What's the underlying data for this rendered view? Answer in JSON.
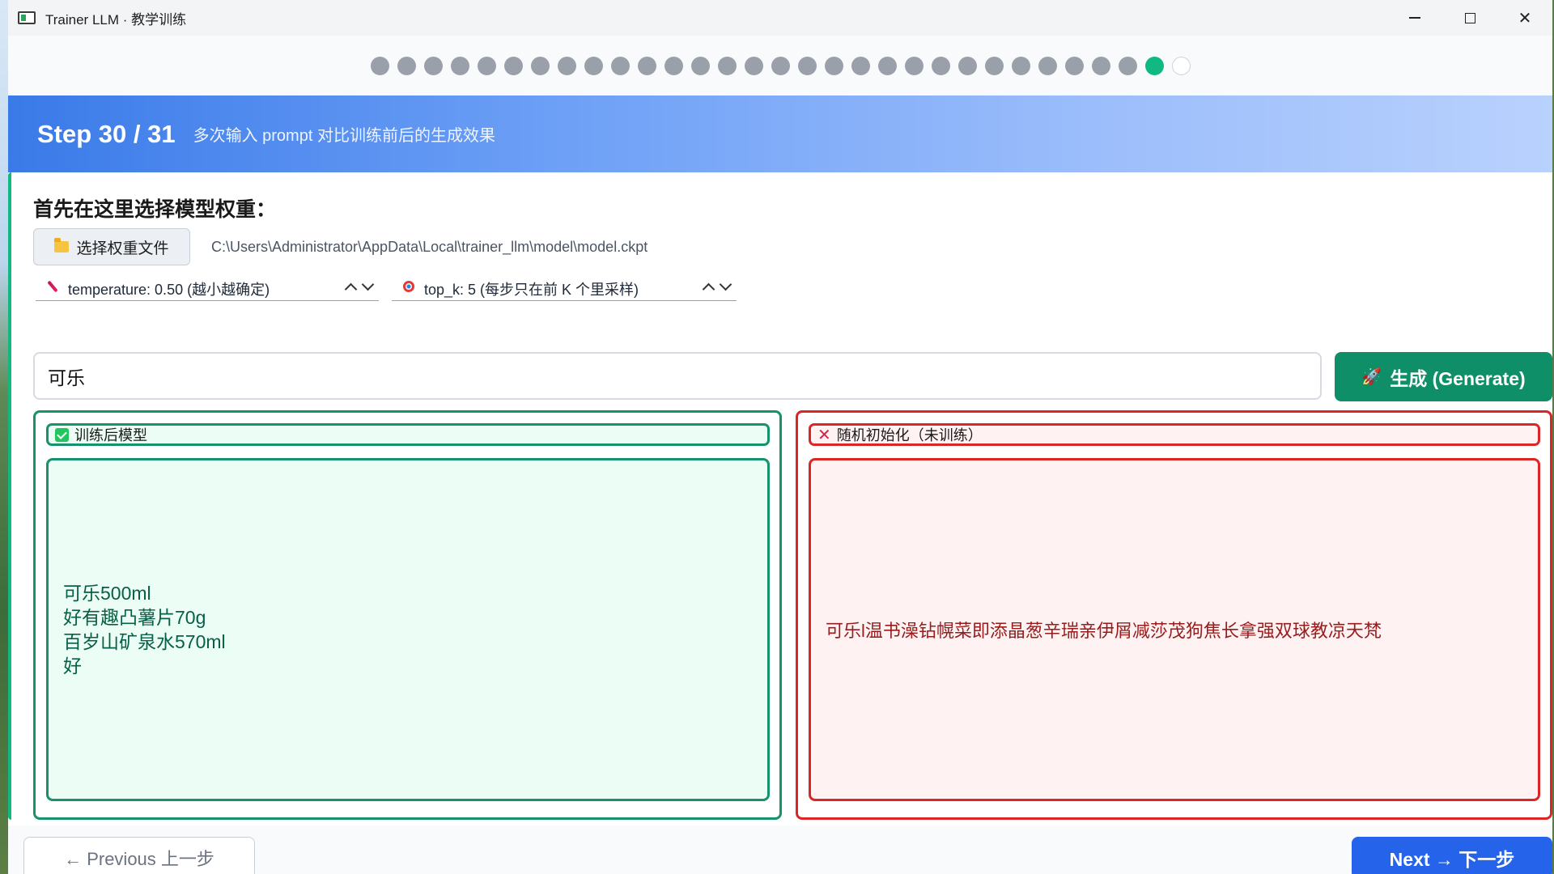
{
  "window": {
    "title": "Trainer LLM · 教学训练",
    "controls": {
      "minimize": "minimize-icon",
      "maximize": "maximize-icon",
      "close": "✕"
    }
  },
  "progress": {
    "total_steps": 31,
    "current_step": 30
  },
  "step": {
    "title": "Step 30 / 31",
    "subtitle": "多次输入 prompt 对比训练前后的生成效果"
  },
  "weights": {
    "section_label": "首先在这里选择模型权重：",
    "choose_button": "选择权重文件",
    "path": "C:\\Users\\Administrator\\AppData\\Local\\trainer_llm\\model\\model.ckpt"
  },
  "params": {
    "temperature": "temperature: 0.50  (越小越确定)",
    "top_k": "top_k: 5  (每步只在前 K 个里采样)"
  },
  "prompt": {
    "value": "可乐"
  },
  "generate_button": "生成 (Generate)",
  "panels": {
    "trained": {
      "label": "训练后模型",
      "output": "可乐500ml\n好有趣凸薯片70g\n百岁山矿泉水570ml\n好"
    },
    "random": {
      "label": "随机初始化（未训练）",
      "output": "可乐l温书澡钻幌菜即添晶葱辛瑞亲伊屑减莎茂狗焦长拿强双球教凉天梵"
    }
  },
  "nav": {
    "previous": "← Previous 上一步",
    "next": "Next → 下一步"
  },
  "colors": {
    "accent_green": "#10b981",
    "generate_green": "#0f8f67",
    "error_red": "#dc2626",
    "primary_blue": "#2563eb"
  }
}
